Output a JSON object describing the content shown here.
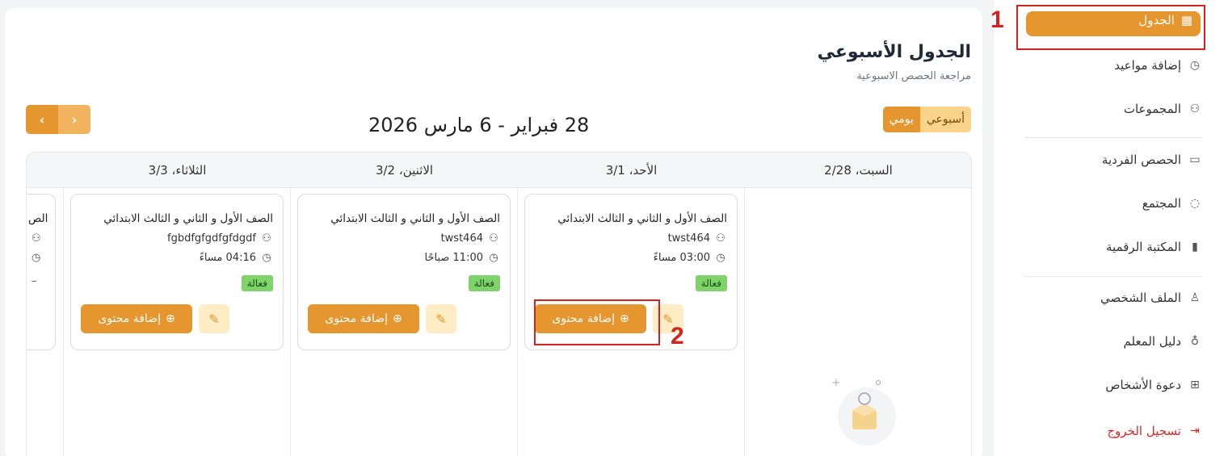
{
  "header": {
    "title": "الجدول الأسبوعي",
    "subtitle": "مراجعة الحصص الاسبوعية",
    "range": "28 فبراير - 6 مارس 2026"
  },
  "view_toggle": {
    "weekly": "أسبوعي",
    "daily": "يومي"
  },
  "nav": {
    "prev": "‹",
    "next": "›"
  },
  "days": [
    {
      "label": "السبت، 2/28"
    },
    {
      "label": "الأحد، 3/1"
    },
    {
      "label": "الاثنين، 3/2"
    },
    {
      "label": "الثلاثاء، 3/3"
    }
  ],
  "cards": [
    {
      "title": "الصف الأول و الثاني و الثالث الابتدائي",
      "group": "twst464",
      "time": "03:00 مساءً",
      "status": "فعالة",
      "add_label": "إضافة محتوى"
    },
    {
      "title": "الصف الأول و الثاني و الثالث الابتدائي",
      "group": "twst464",
      "time": "11:00 صباحًا",
      "status": "فعالة",
      "add_label": "إضافة محتوى"
    },
    {
      "title": "الصف الأول و الثاني و الثالث الابتدائي",
      "group": "fgbdfgfgdfgfdgdf",
      "time": "04:16 مساءً",
      "status": "فعالة",
      "add_label": "إضافة محتوى"
    }
  ],
  "partial_card": {
    "text": "الص",
    "dash": "–"
  },
  "sidebar": {
    "active": {
      "label": "الجدول",
      "icon": "calendar-icon"
    },
    "items": [
      {
        "label": "إضافة مواعيد",
        "icon": "clock-icon"
      },
      {
        "label": "المجموعات",
        "icon": "users-icon"
      },
      {
        "label": "الحصص الفردية",
        "icon": "monitor-icon"
      },
      {
        "label": "المجتمع",
        "icon": "chat-icon"
      },
      {
        "label": "المكتبة الرقمية",
        "icon": "book-icon"
      },
      {
        "label": "الملف الشخصي",
        "icon": "user-icon"
      },
      {
        "label": "دليل المعلم",
        "icon": "bulb-icon"
      },
      {
        "label": "دعوة الأشخاص",
        "icon": "gift-icon"
      },
      {
        "label": "تسجيل الخروج",
        "icon": "logout-icon"
      }
    ]
  },
  "annotations": {
    "one": "1",
    "two": "2"
  },
  "colors": {
    "accent": "#e5962e",
    "accent_light": "#fdecc4",
    "status_green": "#7ed36b",
    "annotation_red": "#d2231e",
    "logout_red": "#dc2626"
  }
}
